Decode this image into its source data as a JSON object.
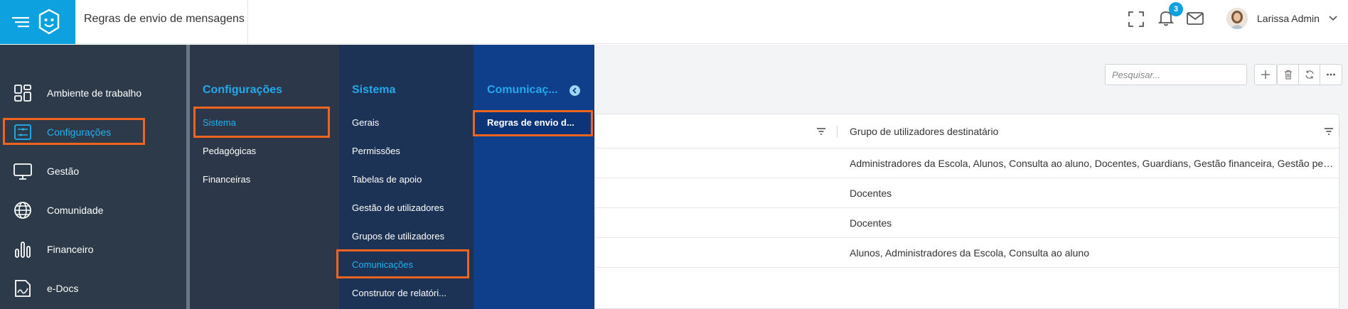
{
  "header": {
    "title": "Regras de envio de mensagens",
    "notification_count": "3",
    "user_name": "Larissa Admin"
  },
  "main_nav": [
    {
      "label": "Ambiente de trabalho",
      "icon": "grid-icon"
    },
    {
      "label": "Configurações",
      "icon": "settings-sliders-icon",
      "active": true
    },
    {
      "label": "Gestão",
      "icon": "monitor-icon"
    },
    {
      "label": "Comunidade",
      "icon": "globe-icon"
    },
    {
      "label": "Financeiro",
      "icon": "bar-chart-icon"
    },
    {
      "label": "e-Docs",
      "icon": "document-signature-icon"
    }
  ],
  "config_panel": {
    "title": "Configurações",
    "items": [
      "Sistema",
      "Pedagógicas",
      "Financeiras"
    ]
  },
  "sistema_panel": {
    "title": "Sistema",
    "items": [
      "Gerais",
      "Permissões",
      "Tabelas de apoio",
      "Gestão de utilizadores",
      "Grupos de utilizadores",
      "Comunicações",
      "Construtor de relatóri..."
    ]
  },
  "comunicacoes_panel": {
    "title": "Comunicaç...",
    "items": [
      "Regras de envio d..."
    ]
  },
  "search": {
    "placeholder": "Pesquisar..."
  },
  "toolbar": [
    "add-icon",
    "trash-icon",
    "refresh-icon",
    "more-icon"
  ],
  "table": {
    "column_header": "Grupo de utilizadores destinatário",
    "rows": [
      "Administradores da Escola, Alunos, Consulta ao aluno, Docentes, Guardians, Gestão financeira, Gestão peda...",
      "Docentes",
      "Docentes",
      "Alunos, Administradores da Escola, Consulta ao aluno"
    ]
  },
  "colors": {
    "brand": "#0ea1e0",
    "highlight": "#f0641e",
    "accent_text": "#23b1f0"
  }
}
